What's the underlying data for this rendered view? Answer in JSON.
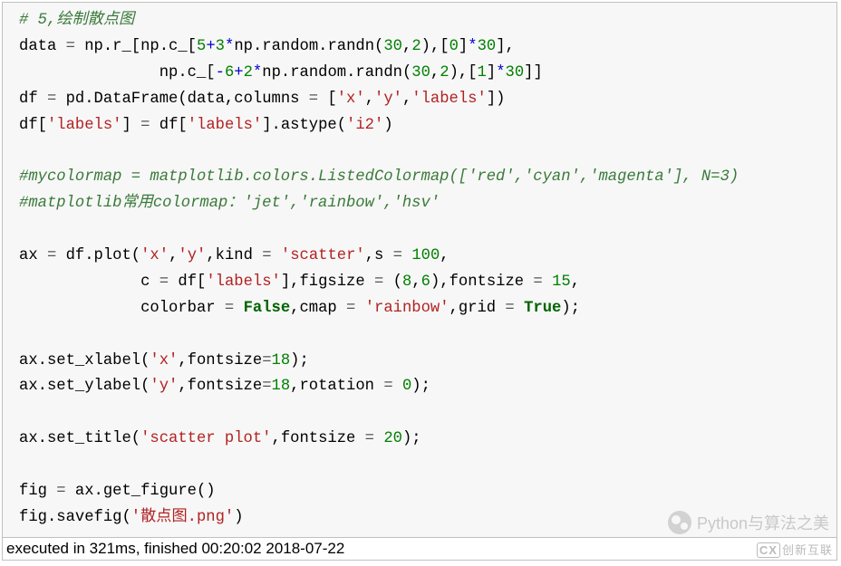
{
  "code": {
    "l1_comment": "# 5,绘制散点图",
    "l2_a": "data ",
    "l2_eq": "=",
    "l2_b": " np.r_[np.c_[",
    "l2_n1": "5",
    "l2_p": "+",
    "l2_n2": "3",
    "l2_m": "*",
    "l2_c": "np.random.randn(",
    "l2_n3": "30",
    "l2_cm": ",",
    "l2_n4": "2",
    "l2_d": "),[",
    "l2_n5": "0",
    "l2_e": "]",
    "l2_m2": "*",
    "l2_n6": "30",
    "l2_f": "],",
    "l3_pad": "               ",
    "l3_a": "np.c_[",
    "l3_neg": "-",
    "l3_n1": "6",
    "l3_p": "+",
    "l3_n2": "2",
    "l3_m": "*",
    "l3_b": "np.random.randn(",
    "l3_n3": "30",
    "l3_cm": ",",
    "l3_n4": "2",
    "l3_c": "),[",
    "l3_n5": "1",
    "l3_d": "]",
    "l3_m2": "*",
    "l3_n6": "30",
    "l3_e": "]]",
    "l4_a": "df ",
    "l4_eq": "=",
    "l4_b": " pd.DataFrame(data,columns ",
    "l4_eq2": "=",
    "l4_c": " [",
    "l4_s1": "'x'",
    "l4_cm": ",",
    "l4_s2": "'y'",
    "l4_cm2": ",",
    "l4_s3": "'labels'",
    "l4_d": "])",
    "l5_a": "df[",
    "l5_s1": "'labels'",
    "l5_b": "] ",
    "l5_eq": "=",
    "l5_c": " df[",
    "l5_s2": "'labels'",
    "l5_d": "].astype(",
    "l5_s3": "'i2'",
    "l5_e": ")",
    "l7_comment": "#mycolormap = matplotlib.colors.ListedColormap(['red','cyan','magenta'], N=3)",
    "l8_comment": "#matplotlib常用colormap：'jet','rainbow','hsv'",
    "l10_a": "ax ",
    "l10_eq": "=",
    "l10_b": " df.plot(",
    "l10_s1": "'x'",
    "l10_cm": ",",
    "l10_s2": "'y'",
    "l10_c": ",kind ",
    "l10_eq2": "=",
    "l10_sp": " ",
    "l10_s3": "'scatter'",
    "l10_d": ",s ",
    "l10_eq3": "=",
    "l10_sp2": " ",
    "l10_n": "100",
    "l10_e": ",",
    "l11_pad": "             ",
    "l11_a": "c ",
    "l11_eq": "=",
    "l11_b": " df[",
    "l11_s1": "'labels'",
    "l11_c": "],figsize ",
    "l11_eq2": "=",
    "l11_d": " (",
    "l11_n1": "8",
    "l11_cm": ",",
    "l11_n2": "6",
    "l11_e": "),fontsize ",
    "l11_eq3": "=",
    "l11_sp": " ",
    "l11_n3": "15",
    "l11_f": ",",
    "l12_pad": "             ",
    "l12_a": "colorbar ",
    "l12_eq": "=",
    "l12_sp": " ",
    "l12_b1": "False",
    "l12_b": ",cmap ",
    "l12_eq2": "=",
    "l12_sp2": " ",
    "l12_s1": "'rainbow'",
    "l12_c": ",grid ",
    "l12_eq3": "=",
    "l12_sp3": " ",
    "l12_b2": "True",
    "l12_d": ");",
    "l14_a": "ax.set_xlabel(",
    "l14_s1": "'x'",
    "l14_b": ",fontsize",
    "l14_eq": "=",
    "l14_n": "18",
    "l14_c": ");",
    "l15_a": "ax.set_ylabel(",
    "l15_s1": "'y'",
    "l15_b": ",fontsize",
    "l15_eq": "=",
    "l15_n": "18",
    "l15_c": ",rotation ",
    "l15_eq2": "=",
    "l15_sp": " ",
    "l15_n2": "0",
    "l15_d": ");",
    "l17_a": "ax.set_title(",
    "l17_s1": "'scatter plot'",
    "l17_b": ",fontsize ",
    "l17_eq": "=",
    "l17_sp": " ",
    "l17_n": "20",
    "l17_c": ");",
    "l19_a": "fig ",
    "l19_eq": "=",
    "l19_b": " ax.get_figure()",
    "l20_a": "fig.savefig(",
    "l20_s1": "'散点图.png'",
    "l20_b": ")"
  },
  "status": "executed in 321ms, finished 00:20:02 2018-07-22",
  "watermark_text": "Python与算法之美",
  "brand": "创新互联"
}
